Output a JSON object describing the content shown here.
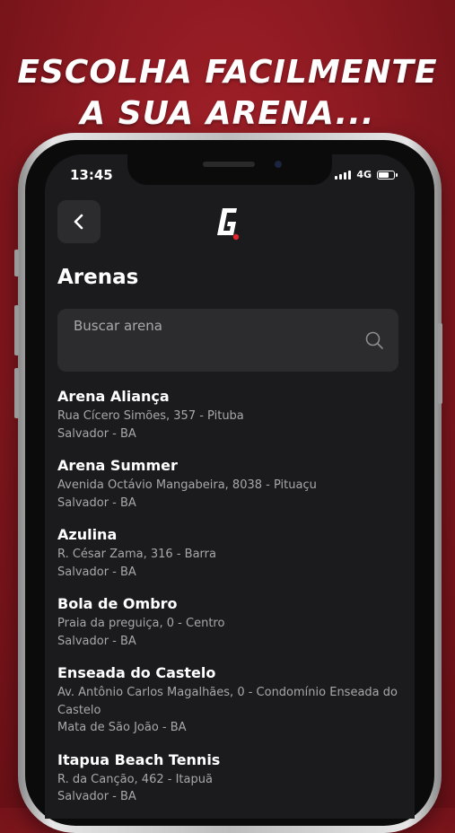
{
  "promo": {
    "line1": "ESCOLHA FACILMENTE",
    "line2": "A SUA ARENA..."
  },
  "status_bar": {
    "time": "13:45",
    "network": "4G"
  },
  "header": {
    "back_icon": "chevron-left-icon",
    "logo_letter": "G"
  },
  "page": {
    "title": "Arenas"
  },
  "search": {
    "placeholder": "Buscar arena",
    "icon": "search-icon"
  },
  "arenas": [
    {
      "name": "Arena Aliança",
      "address": "Rua Cícero Simões, 357 - Pituba",
      "city": "Salvador - BA"
    },
    {
      "name": "Arena Summer",
      "address": "Avenida Octávio Mangabeira, 8038 - Pituaçu",
      "city": "Salvador - BA"
    },
    {
      "name": "Azulina",
      "address": "R. César Zama, 316 - Barra",
      "city": "Salvador - BA"
    },
    {
      "name": "Bola de Ombro",
      "address": "Praia da preguiça, 0 - Centro",
      "city": "Salvador - BA"
    },
    {
      "name": "Enseada do Castelo",
      "address": "Av. Antônio Carlos Magalhães, 0 - Condomínio Enseada do Castelo",
      "city": "Mata de São João - BA"
    },
    {
      "name": "Itapua Beach Tennis",
      "address": "R. da Canção, 462 - Itapuã",
      "city": "Salvador - BA"
    }
  ],
  "colors": {
    "background": "#8e1a22",
    "screen": "#1b1b1d",
    "card": "#2c2c2f",
    "accent": "#e0282e"
  }
}
